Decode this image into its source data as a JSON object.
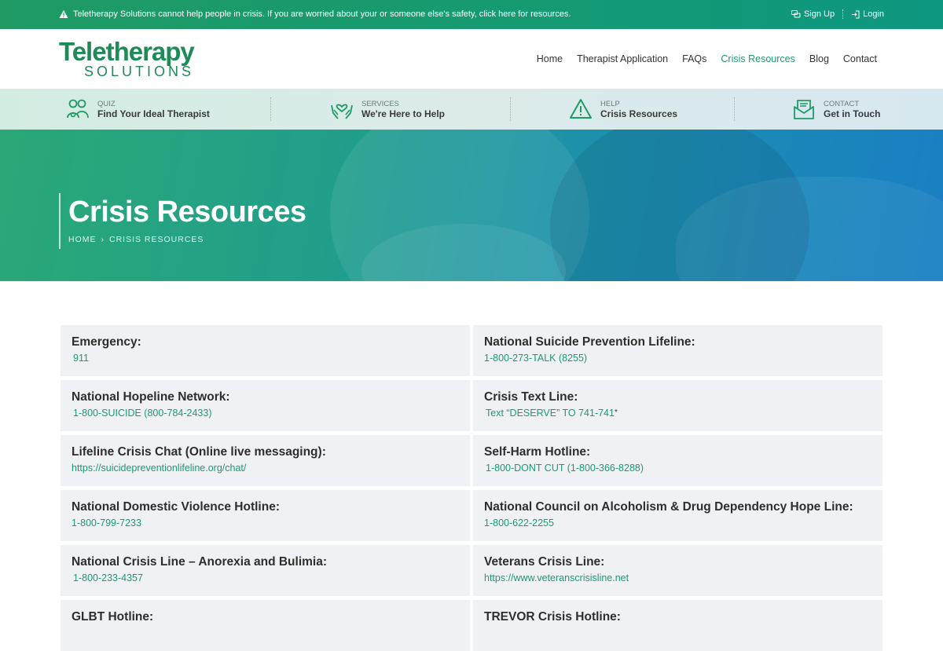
{
  "alert": {
    "message": "Teletherapy Solutions cannot help people in crisis. If you are worried about your or someone else's safety, click here for resources.",
    "signup": "Sign Up",
    "login": "Login"
  },
  "logo": {
    "top": "Teletherapy",
    "bottom": "SOLUTIONS"
  },
  "nav": [
    "Home",
    "Therapist Application",
    "FAQs",
    "Crisis Resources",
    "Blog",
    "Contact"
  ],
  "nav_active": "Crisis Resources",
  "strip": [
    {
      "kicker": "QUIZ",
      "title": "Find Your Ideal Therapist",
      "icon": "people-icon"
    },
    {
      "kicker": "SERVICES",
      "title": "We're Here to Help",
      "icon": "hands-heart-icon"
    },
    {
      "kicker": "HELP",
      "title": "Crisis Resources",
      "icon": "warning-icon"
    },
    {
      "kicker": "CONTACT",
      "title": "Get in Touch",
      "icon": "envelope-icon"
    }
  ],
  "hero": {
    "title": "Crisis Resources",
    "breadcrumb_home": "HOME",
    "breadcrumb_sep": "›",
    "breadcrumb_current": "CRISIS RESOURCES"
  },
  "resources": [
    {
      "title": "Emergency:",
      "value": "911"
    },
    {
      "title": "National Suicide Prevention Lifeline:",
      "value": "1-800-273-TALK (8255)"
    },
    {
      "title": "National Hopeline Network:",
      "value": "1-800-SUICIDE (800-784-2433)"
    },
    {
      "title": "Crisis Text Line:",
      "value": "Text “DESERVE” TO 741-741",
      "suffix": "*"
    },
    {
      "title": "Lifeline Crisis Chat (Online live messaging):",
      "value": "https://suicidepreventionlifeline.org/chat/"
    },
    {
      "title": "Self-Harm Hotline:",
      "value": "1-800-DONT CUT (1-800-366-8288)"
    },
    {
      "title": "National Domestic Violence Hotline:",
      "value": "1-800-799-7233"
    },
    {
      "title": "National Council on Alcoholism & Drug Dependency Hope Line:",
      "value": "1-800-622-2255"
    },
    {
      "title": "National Crisis Line – Anorexia and Bulimia:",
      "value": "1-800-233-4357"
    },
    {
      "title": "Veterans Crisis Line:",
      "value": "https://www.veteranscrisisline.net"
    },
    {
      "title": "GLBT Hotline:",
      "value": ""
    },
    {
      "title": "TREVOR Crisis Hotline:",
      "value": ""
    }
  ],
  "colors": {
    "brand_green": "#1e8a57",
    "link_green": "#1a9a72",
    "card_bg": "#eff1f4"
  }
}
